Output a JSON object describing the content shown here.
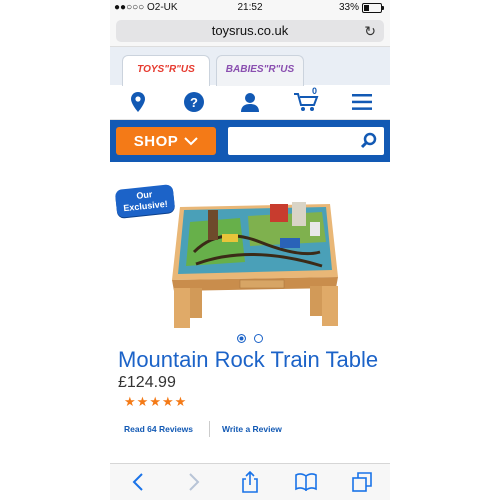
{
  "status_bar": {
    "carrier": "●●○○○ O2-UK",
    "time": "21:52",
    "battery": "33%",
    "battery_level": 0.33
  },
  "browser": {
    "url": "toysrus.co.uk"
  },
  "brand_tabs": {
    "toysrus": "TOYS\"R\"US",
    "babiesrus": "BABIES\"R\"US"
  },
  "nav": {
    "cart_count": "0"
  },
  "shop_bar": {
    "shop_label": "SHOP",
    "search_placeholder": ""
  },
  "product": {
    "badge_line1": "Our",
    "badge_line2": "Exclusive!",
    "title": "Mountain Rock Train Table",
    "price": "£124.99",
    "rating": 5,
    "rating_max": 5,
    "read_reviews": "Read 64 Reviews",
    "write_review": "Write a Review",
    "carousel_index": 1,
    "carousel_total": 2
  },
  "colors": {
    "brand_blue": "#1259b4",
    "accent_orange": "#f47a17"
  }
}
